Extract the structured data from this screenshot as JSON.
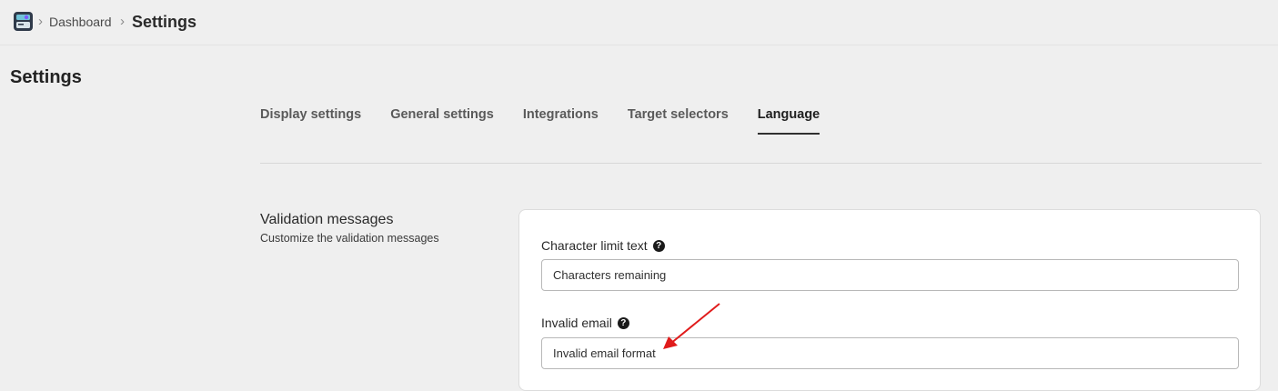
{
  "breadcrumb": {
    "separator": "›",
    "dashboard": "Dashboard",
    "current": "Settings"
  },
  "page": {
    "title": "Settings"
  },
  "tabs": [
    {
      "label": "Display settings",
      "active": false
    },
    {
      "label": "General settings",
      "active": false
    },
    {
      "label": "Integrations",
      "active": false
    },
    {
      "label": "Target selectors",
      "active": false
    },
    {
      "label": "Language",
      "active": true
    }
  ],
  "validation": {
    "title": "Validation messages",
    "description": "Customize the validation messages",
    "fields": [
      {
        "label": "Character limit text",
        "value": "Characters remaining",
        "help_icon": "question-circle-icon"
      },
      {
        "label": "Invalid email",
        "value": "Invalid email format",
        "help_icon": "question-circle-icon"
      }
    ]
  },
  "help_glyph": "?",
  "annotation": {
    "type": "red-arrow",
    "color": "#e01b1b"
  },
  "colors": {
    "background": "#efefef",
    "card": "#ffffff",
    "active_tab_underline": "#303030"
  }
}
